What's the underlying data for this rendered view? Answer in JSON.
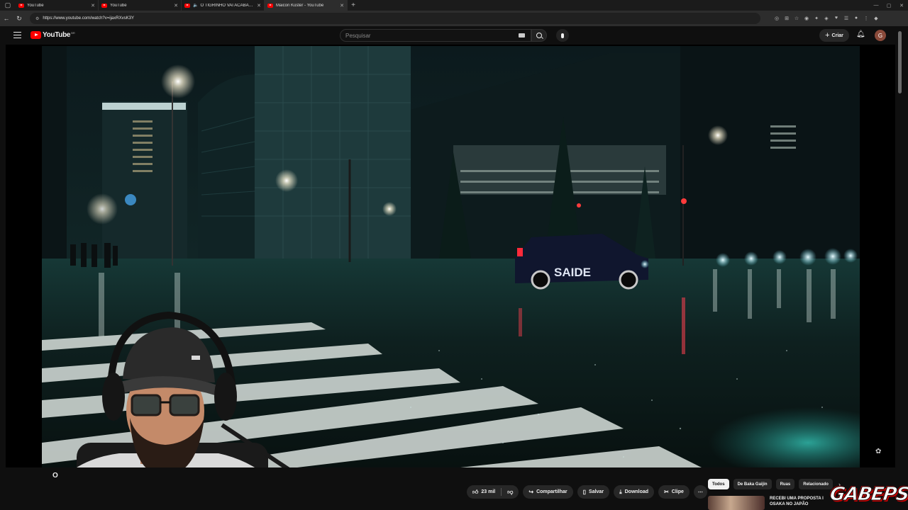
{
  "browser": {
    "tabs": [
      {
        "title": "YouTube",
        "active": false,
        "audio": false
      },
      {
        "title": "YouTube",
        "active": false,
        "audio": false
      },
      {
        "title": "O TIGRINHO VAI ACABAR O",
        "active": false,
        "audio": true
      },
      {
        "title": "Maicon Küster - YouTube",
        "active": true,
        "audio": false
      }
    ],
    "url": "https://www.youtube.com/watch?v=ijaxRXvsK3Y"
  },
  "youtube": {
    "logo_text": "YouTube",
    "logo_country": "BR",
    "search_placeholder": "Pesquisar",
    "create_label": "Criar",
    "avatar_letter": "G"
  },
  "video": {
    "title_fragment": "O",
    "car_text": "SAIDE"
  },
  "actions": {
    "likes": "23 mil",
    "share": "Compartilhar",
    "save": "Salvar",
    "download": "Download",
    "clip": "Clipe"
  },
  "chips": [
    "Todos",
    "De Baka Gaijin",
    "Ruas",
    "Relacionado"
  ],
  "recommendation": {
    "title": "RECEBI UMA PROPOSTA I OSAKA NO JAPÃO"
  },
  "overlay": {
    "brand_text": "GABEPS",
    "headset_brand": "intel"
  }
}
